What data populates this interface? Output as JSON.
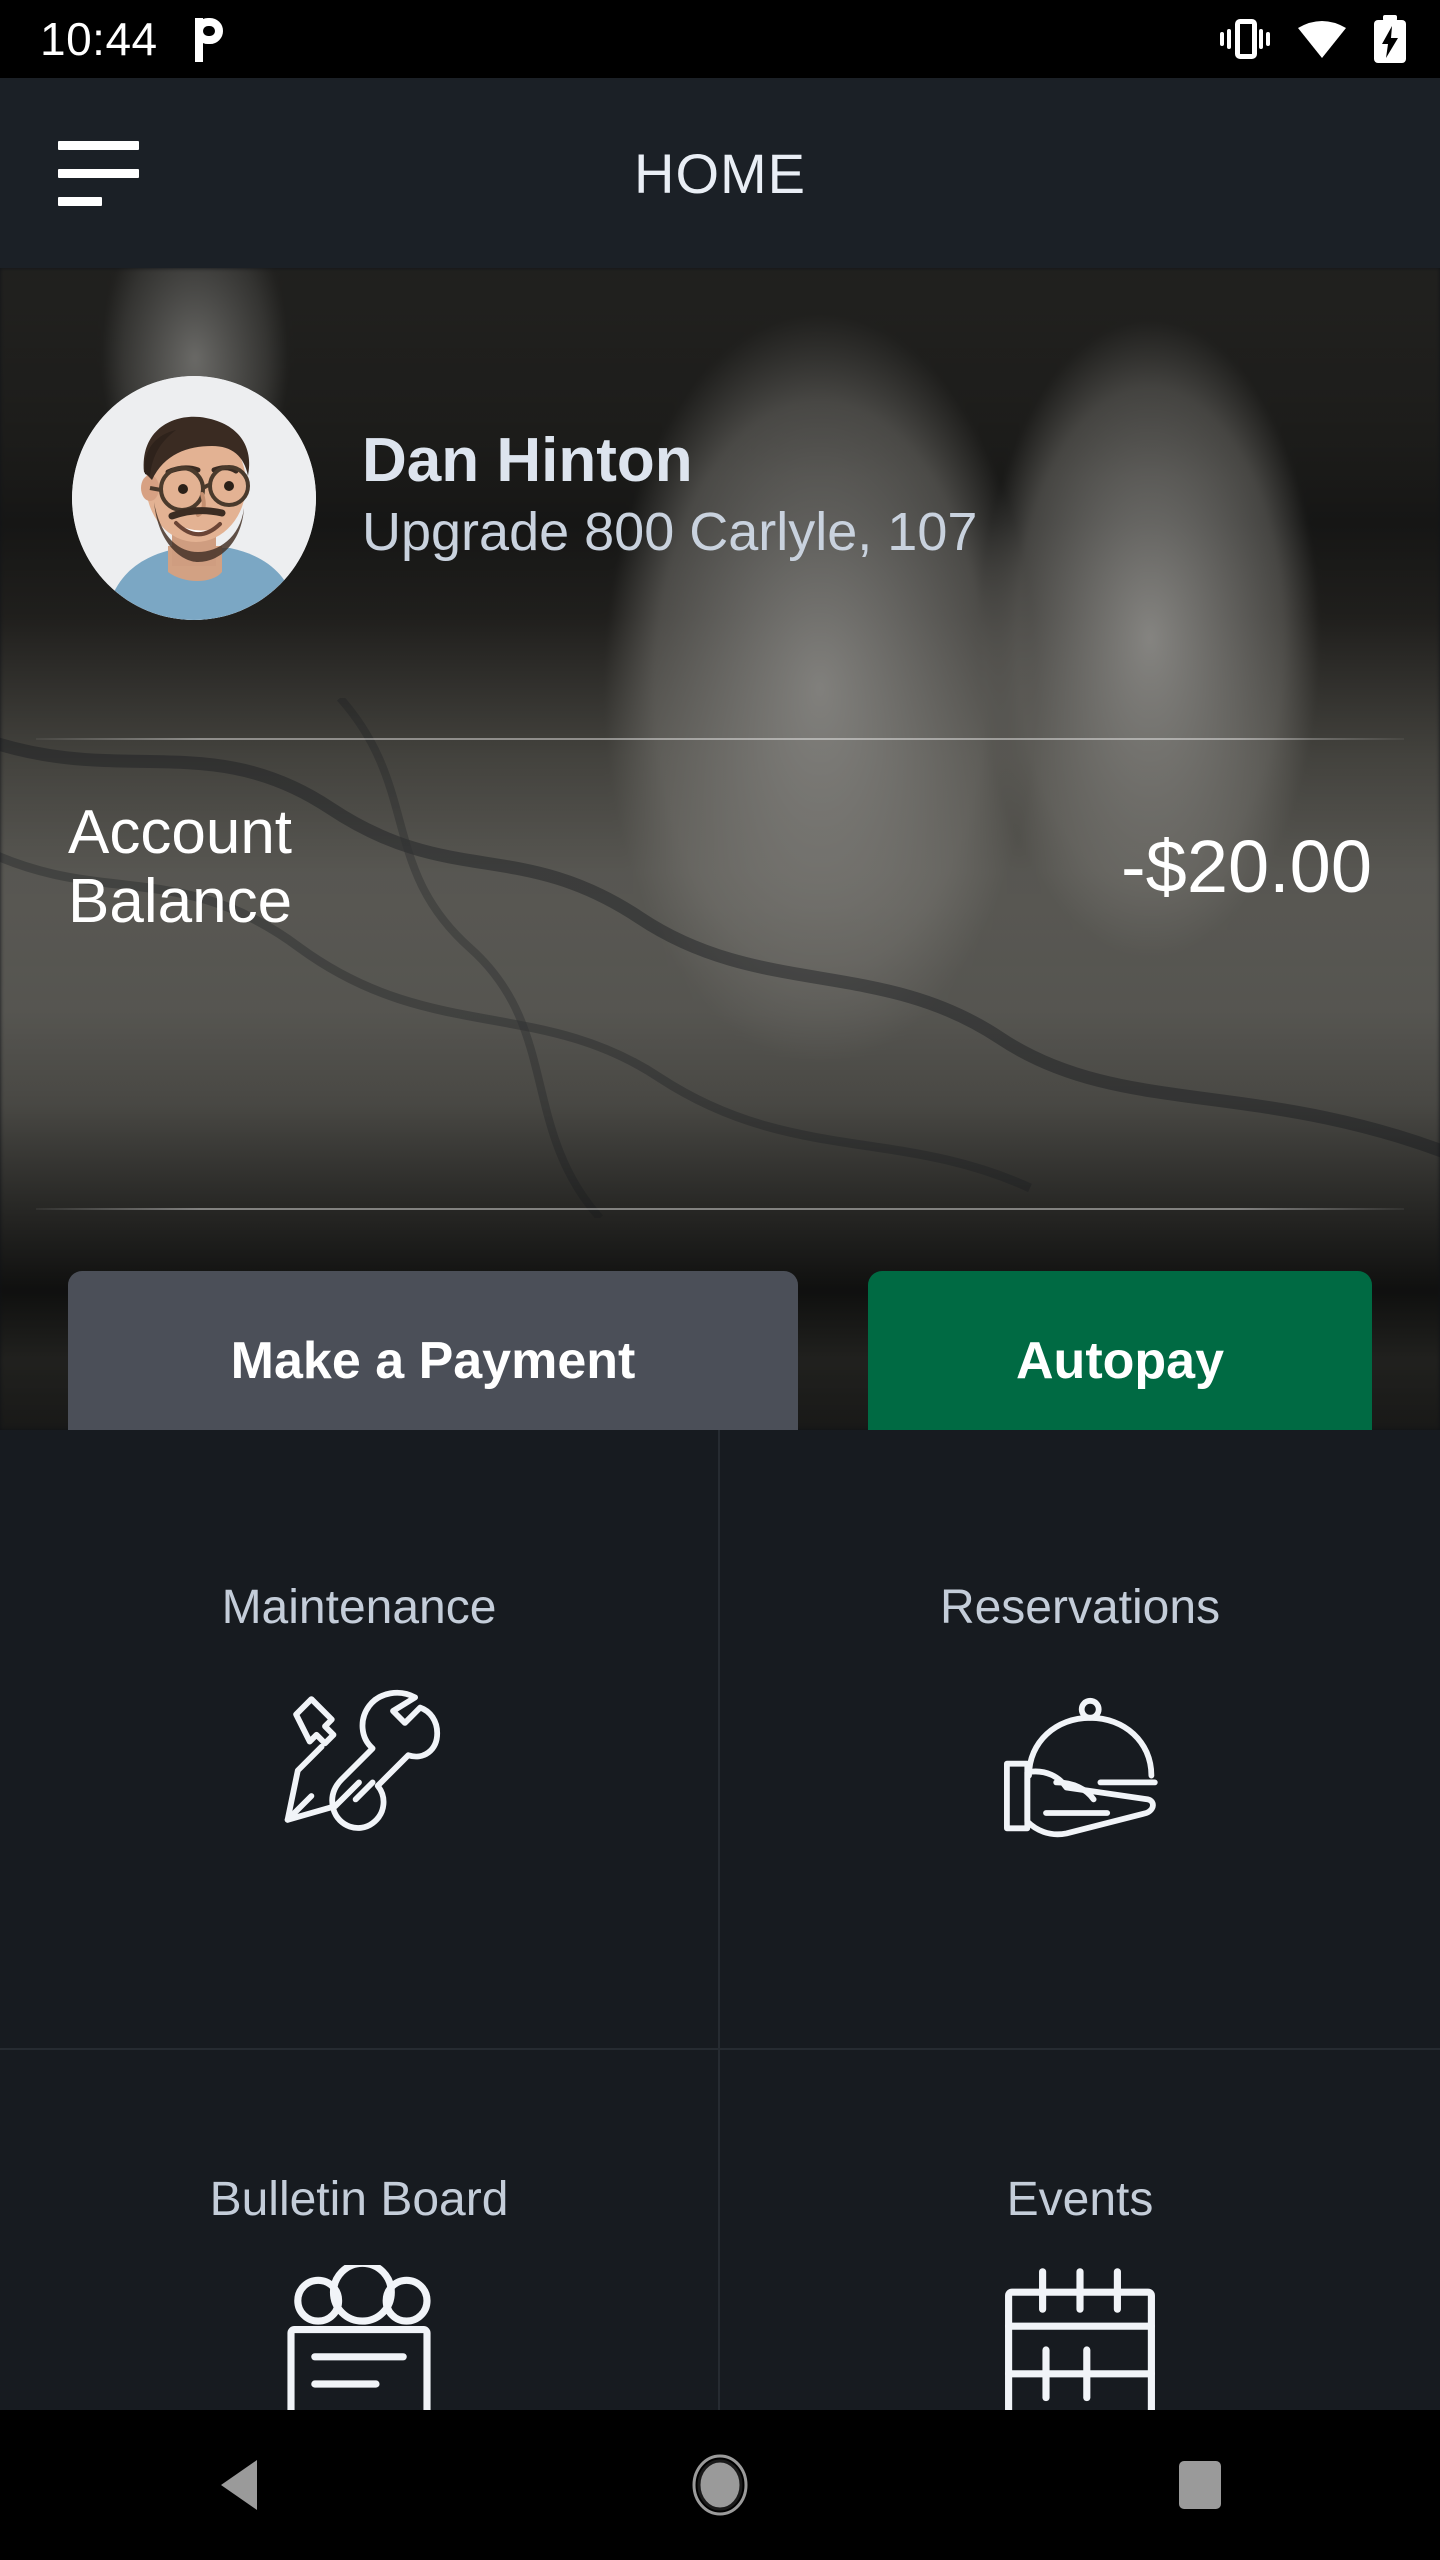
{
  "statusbar": {
    "time": "10:44",
    "icons": [
      "pandora-icon",
      "vibrate-icon",
      "wifi-icon",
      "battery-charging-icon"
    ]
  },
  "appbar": {
    "menu_icon": "hamburger-menu-icon",
    "title": "HOME"
  },
  "profile": {
    "avatar_alt": "user-avatar",
    "name": "Dan Hinton",
    "address": "Upgrade 800 Carlyle, 107"
  },
  "balance": {
    "label": "Account Balance",
    "amount": "-$20.00"
  },
  "actions": {
    "make_payment": "Make a Payment",
    "autopay": "Autopay"
  },
  "tiles": [
    {
      "label": "Maintenance",
      "icon": "tools-icon"
    },
    {
      "label": "Reservations",
      "icon": "serving-dome-hand-icon"
    },
    {
      "label": "Bulletin Board",
      "icon": "bulletin-board-icon"
    },
    {
      "label": "Events",
      "icon": "calendar-icon"
    }
  ],
  "navbar": {
    "back": "back-button",
    "home": "home-button",
    "recents": "recents-button"
  },
  "colors": {
    "status_bar": "#000000",
    "app_bar": "#1b2026",
    "grid_bg": "#171b20",
    "divider": "#262b31",
    "accent_green": "#006a43",
    "secondary_gray": "#4b4f58",
    "label_text": "#c4cdd9",
    "primary_text": "#ffffff"
  }
}
